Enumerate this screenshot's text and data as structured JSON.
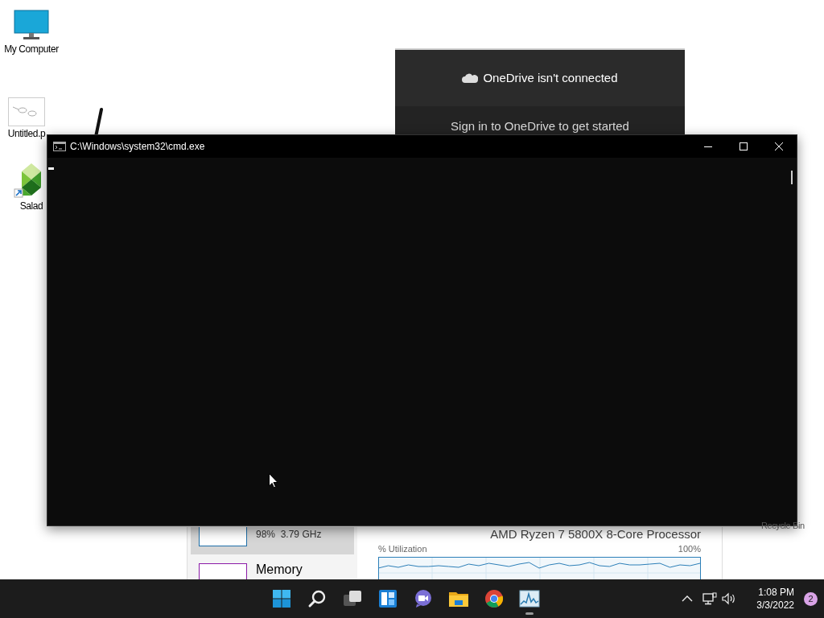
{
  "desktop_icons": [
    {
      "kind": "monitor",
      "label": "My Computer"
    },
    {
      "kind": "image",
      "label": "Untitled.p"
    },
    {
      "kind": "salad",
      "label": "Salad"
    }
  ],
  "recycle_bin": {
    "label": "Recycle Bin"
  },
  "onedrive": {
    "title": "OneDrive isn't connected",
    "message": "Sign in to OneDrive to get started"
  },
  "task_manager": {
    "sidebar": [
      {
        "detail": "98%  3.79 GHz",
        "selected": true,
        "color": "#1f6fa8"
      },
      {
        "label": "Memory",
        "selected": false,
        "color": "#8b1aa8"
      }
    ],
    "processor": "AMD Ryzen 7 5800X 8-Core Processor",
    "graph_label": "% Utilization",
    "graph_max": "100%"
  },
  "console": {
    "title": "C:\\Windows\\system32\\cmd.exe"
  },
  "taskbar": {
    "apps": [
      {
        "kind": "start",
        "running": false
      },
      {
        "kind": "search",
        "running": false
      },
      {
        "kind": "task-view",
        "running": false
      },
      {
        "kind": "widgets",
        "running": false
      },
      {
        "kind": "chat",
        "running": false
      },
      {
        "kind": "explorer",
        "running": false
      },
      {
        "kind": "browser",
        "running": false
      },
      {
        "kind": "task-manager",
        "running": true
      }
    ],
    "time": "1:08 PM",
    "date": "3/3/2022",
    "notifications": "2"
  }
}
